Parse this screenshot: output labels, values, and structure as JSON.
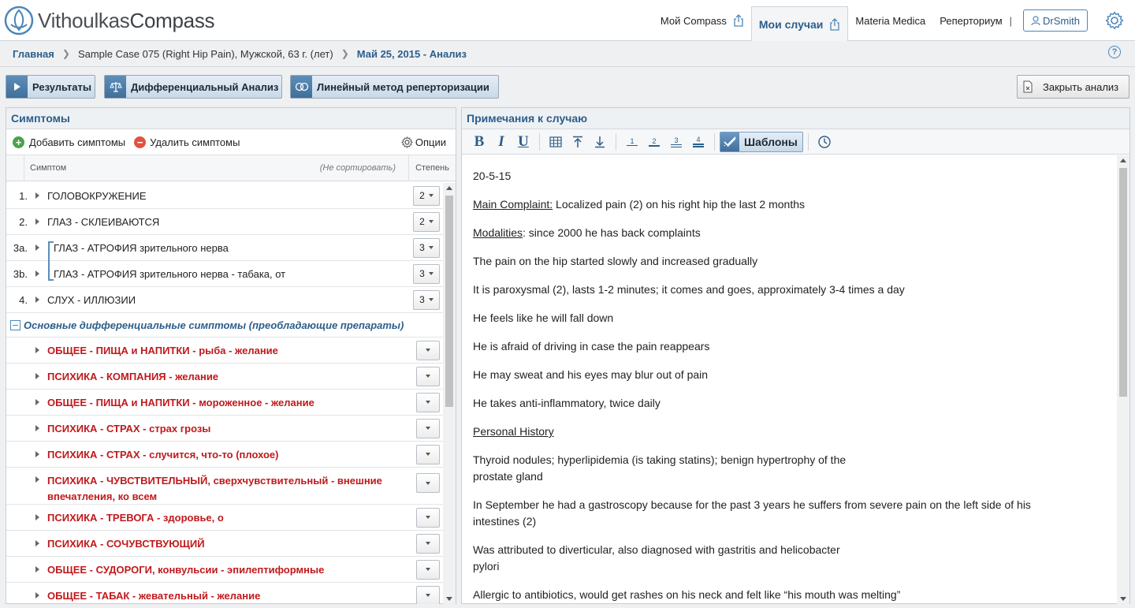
{
  "app": {
    "logo_light": "Vithoulkas",
    "logo_bold": "Compass"
  },
  "nav": {
    "my_compass": "Мой Compass",
    "my_cases": "Мои случаи",
    "materia_medica": "Materia Medica",
    "repertory": "Реперториум",
    "separator": "|",
    "user": "DrSmith"
  },
  "breadcrumb": {
    "home": "Главная",
    "case": "Sample Case 075 (Right Hip Pain), Мужской, 63 г. (лет)",
    "analysis": "Май 25, 2015 - Анализ"
  },
  "help": "?",
  "toolbar": {
    "results": "Результаты",
    "differential": "Дифференциальный Анализ",
    "linear": "Линейный метод реперторизации",
    "close": "Закрыть анализ"
  },
  "symptoms": {
    "title": "Симптомы",
    "add": "Добавить симптомы",
    "remove": "Удалить симптомы",
    "options": "Опции",
    "col_symptom": "Симптом",
    "col_sort": "(Не сортировать)",
    "col_degree": "Степень",
    "rows": [
      {
        "num": "1.",
        "text": "ГОЛОВОКРУЖЕНИЕ",
        "degree": "2"
      },
      {
        "num": "2.",
        "text": "ГЛАЗ - СКЛЕИВАЮТСЯ",
        "degree": "2"
      },
      {
        "num": "3a.",
        "text": "ГЛАЗ - АТРОФИЯ зрительного нерва",
        "degree": "3"
      },
      {
        "num": "3b.",
        "text": "ГЛАЗ - АТРОФИЯ зрительного нерва - табака, от",
        "degree": "3"
      },
      {
        "num": "4.",
        "text": "СЛУХ - ИЛЛЮЗИИ",
        "degree": "3"
      }
    ],
    "group": "Основные дифференциальные симптомы (преобладающие препараты)",
    "red_rows": [
      "ОБЩЕЕ - ПИЩА и НАПИТКИ - рыба - желание",
      "ПСИХИКА - КОМПАНИЯ - желание",
      "ОБЩЕЕ - ПИЩА и НАПИТКИ - мороженное - желание",
      "ПСИХИКА - СТРАХ - страх грозы",
      "ПСИХИКА - СТРАХ - случится, что-то (плохое)",
      "ПСИХИКА - ЧУВСТВИТЕЛЬНЫЙ, сверхчувствительный - внешние впечатления, ко всем",
      "ПСИХИКА - ТРЕВОГА - здоровье, о",
      "ПСИХИКА - СОЧУВСТВУЮЩИЙ",
      "ОБЩЕЕ - СУДОРОГИ, конвульсии - эпилептиформные",
      "ОБЩЕЕ - ТАБАК - жевательный - желание"
    ]
  },
  "notes": {
    "title": "Примечания к случаю",
    "tools": {
      "bold": "B",
      "italic": "I",
      "underline": "U",
      "h1": "1",
      "h2": "2",
      "h3": "3",
      "h4": "4",
      "templates": "Шаблоны"
    },
    "date": "20-5-15",
    "main_label": "Main Complaint:",
    "main_text": " Localized pain (2) on his right hip the last 2 months",
    "mod_label": "Modalities",
    "mod_text": ": since 2000 he has back complaints",
    "p1": "The pain on the hip started slowly and increased gradually",
    "p2": "It is paroxysmal (2), lasts 1-2 minutes; it comes and goes, approximately 3-4 times a day",
    "p3": "He feels like he will fall down",
    "p4": "He is afraid of driving in case the pain reappears",
    "p5": "He may sweat and his eyes may blur out of pain",
    "p6": "He takes anti-inflammatory, twice daily",
    "personal": "Personal History",
    "p7a": "Thyroid nodules; hyperlipidemia (is taking statins); benign hypertrophy of the",
    "p7b": "prostate gland",
    "p8a": "In September he had a gastroscopy because for the past 3 years he suffers from severe pain on the left side of his",
    "p8b": "intestines (2)",
    "p9a": "Was attributed to diverticular, also diagnosed with gastritis and helicobacter",
    "p9b": "pylori",
    "p10": "Allergic to antibiotics, would get rashes on his neck and felt like “his mouth was melting”"
  }
}
